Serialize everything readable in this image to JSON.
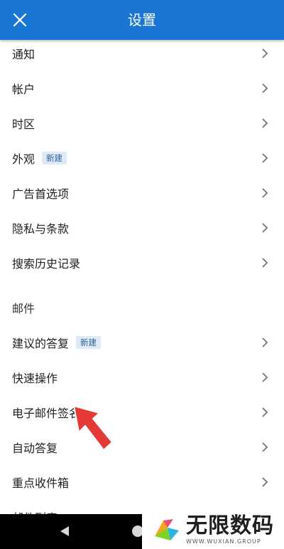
{
  "header": {
    "title": "设置"
  },
  "general_items": [
    {
      "label": "通知"
    },
    {
      "label": "帐户"
    },
    {
      "label": "时区"
    },
    {
      "label": "外观",
      "badge": "新建"
    },
    {
      "label": "广告首选项"
    },
    {
      "label": "隐私与条款"
    },
    {
      "label": "搜索历史记录"
    }
  ],
  "mail_section": {
    "title": "邮件"
  },
  "mail_items": [
    {
      "label": "建议的答复",
      "badge": "新建"
    },
    {
      "label": "快速操作"
    },
    {
      "label": "电子邮件签名"
    },
    {
      "label": "自动答复"
    },
    {
      "label": "重点收件箱"
    },
    {
      "label": "邮件列表"
    }
  ],
  "watermark": {
    "cn": "无限数码",
    "en": "WWW.WUXIAN.GROUP"
  },
  "colors": {
    "header": "#1976d2",
    "badge_bg": "#dfeaf7",
    "annotation_arrow": "#e53935"
  }
}
